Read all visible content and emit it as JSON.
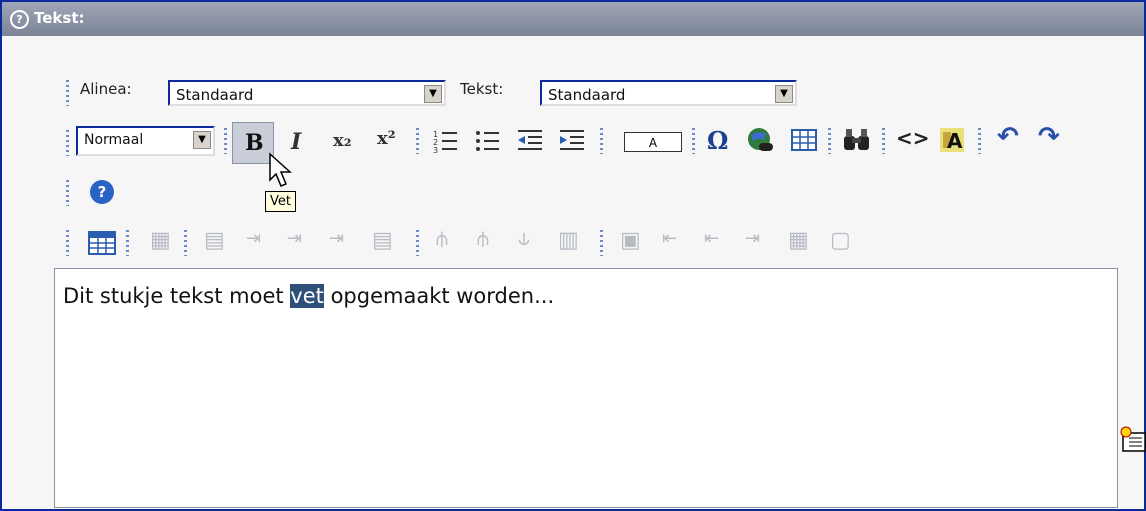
{
  "panel": {
    "title": "Tekst:"
  },
  "toolbar1": {
    "alinea_label": "Alinea:",
    "alinea_value": "Standaard",
    "tekst_label": "Tekst:",
    "tekst_value": "Standaard"
  },
  "toolbar2": {
    "size_value": "Normaal",
    "bold_glyph": "B",
    "italic_glyph": "I",
    "subscript_glyph": "x₂",
    "superscript_glyph": "x²",
    "textcolor_glyph": "A",
    "special_char_glyph": "Ω",
    "find_glyph": "🔍",
    "source_glyph": "<>",
    "tooltip": "Vet"
  },
  "editor": {
    "text_before": "Dit stukje tekst moet ",
    "text_selected": "vet",
    "text_after": " opgemaakt worden..."
  },
  "icons": [
    "help-icon",
    "ordered-list-icon",
    "unordered-list-icon",
    "outdent-icon",
    "indent-icon",
    "special-char-icon",
    "link-icon",
    "table-icon",
    "find-icon",
    "source-icon",
    "spellcheck-icon",
    "undo-icon",
    "redo-icon",
    "about-icon",
    "insert-table-icon"
  ]
}
